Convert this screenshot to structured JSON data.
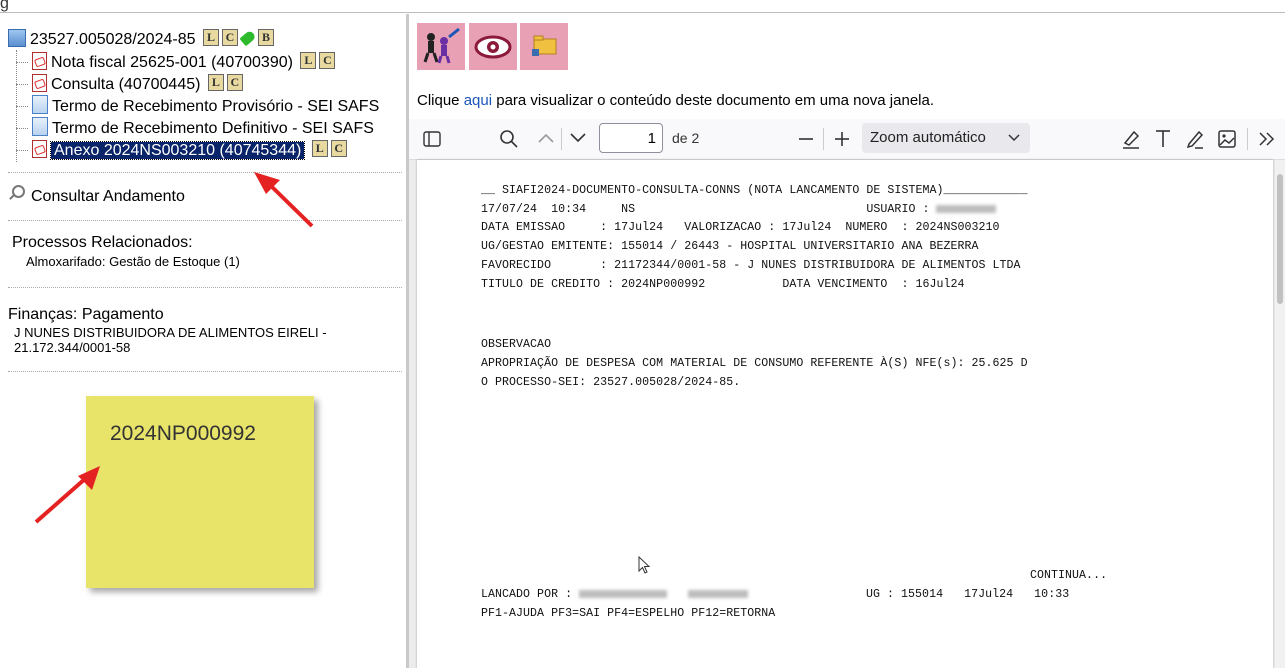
{
  "top_glyph": "g",
  "tree": {
    "process": {
      "label": "23527.005028/2024-85",
      "buttons": [
        "L",
        "C",
        "B"
      ]
    },
    "docs": [
      {
        "label": "Nota fiscal 25625-001 (40700390)",
        "type": "pdf",
        "buttons": [
          "L",
          "C"
        ]
      },
      {
        "label": "Consulta (40700445)",
        "type": "pdf",
        "buttons": [
          "L",
          "C"
        ]
      },
      {
        "label": "Termo de Recebimento Provisório - SEI SAFS",
        "type": "doc",
        "buttons": []
      },
      {
        "label": "Termo de Recebimento Definitivo - SEI SAFS",
        "type": "doc",
        "buttons": []
      },
      {
        "label": "Anexo 2024NS003210 (40745344)",
        "type": "pdf",
        "buttons": [
          "L",
          "C"
        ],
        "selected": true
      }
    ]
  },
  "consultar_andamento": "Consultar Andamento",
  "processos_relacionados": {
    "title": "Processos Relacionados:",
    "item": "Almoxarifado: Gestão de Estoque (1)"
  },
  "financas": {
    "title": "Finanças: Pagamento",
    "line1": "J NUNES DISTRIBUIDORA DE ALIMENTOS EIRELI -",
    "line2": "21.172.344/0001-58"
  },
  "sticky_note": "2024NP000992",
  "viewer": {
    "link_prefix": "Clique ",
    "link_text": "aqui",
    "link_suffix": " para visualizar o conteúdo deste documento em uma nova janela.",
    "page_number": "1",
    "page_total": "de 2",
    "zoom": "Zoom automático"
  },
  "document": {
    "line1": "__ SIAFI2024-DOCUMENTO-CONSULTA-CONNS (NOTA LANCAMENTO DE SISTEMA)____________",
    "line2a": "17/07/24  10:34     NS                                 USUARIO : ",
    "line3": "DATA EMISSAO     : 17Jul24   VALORIZACAO : 17Jul24  NUMERO  : 2024NS003210",
    "line4": "UG/GESTAO EMITENTE: 155014 / 26443 - HOSPITAL UNIVERSITARIO ANA BEZERRA",
    "line5": "FAVORECIDO       : 21172344/0001-58 - J NUNES DISTRIBUIDORA DE ALIMENTOS LTDA",
    "line6": "TITULO DE CREDITO : 2024NP000992           DATA VENCIMENTO  : 16Jul24",
    "line7": "OBSERVACAO",
    "line8": "APROPRIAÇÃO DE DESPESA COM MATERIAL DE CONSUMO REFERENTE À(S) NFE(s): 25.625 D",
    "line9": "O PROCESSO-SEI: 23527.005028/2024-85.",
    "line10": "CONTINUA...",
    "line11a": "LANCADO POR : ",
    "line11b": "UG : 155014   17Jul24   10:33",
    "line12": "PF1-AJUDA PF3=SAI PF4=ESPELHO PF12=RETORNA"
  },
  "colors": {
    "selection": "#0a246a",
    "link": "#1a55b8",
    "note": "#e8e46a",
    "arrow": "#e52222",
    "toolbar_button": "#e7a0b4"
  }
}
